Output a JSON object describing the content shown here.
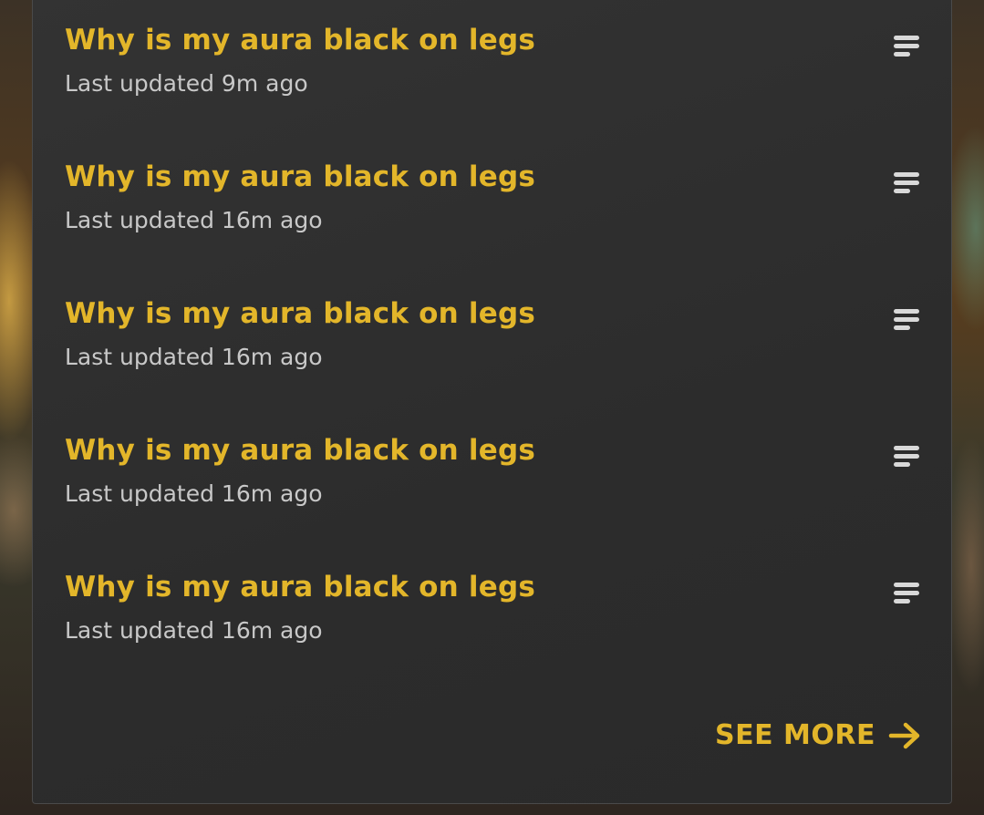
{
  "threads": [
    {
      "title": "Why is my aura black on legs",
      "updated": "Last updated 9m ago",
      "icon": "text-lines-icon"
    },
    {
      "title": "Why is my aura black on legs",
      "updated": "Last updated 16m ago",
      "icon": "text-lines-icon"
    },
    {
      "title": "Why is my aura black on legs",
      "updated": "Last updated 16m ago",
      "icon": "text-lines-icon"
    },
    {
      "title": "Why is my aura black on legs",
      "updated": "Last updated 16m ago",
      "icon": "text-lines-icon"
    },
    {
      "title": "Why is my aura black on legs",
      "updated": "Last updated 16m ago",
      "icon": "text-lines-icon"
    }
  ],
  "see_more": {
    "label": "SEE MORE",
    "icon": "arrow-right-icon"
  },
  "colors": {
    "accent": "#e3b62a",
    "panel_bg": "#2f2f2f",
    "meta_text": "#c8c8c8",
    "icon": "#d9d9d9"
  }
}
